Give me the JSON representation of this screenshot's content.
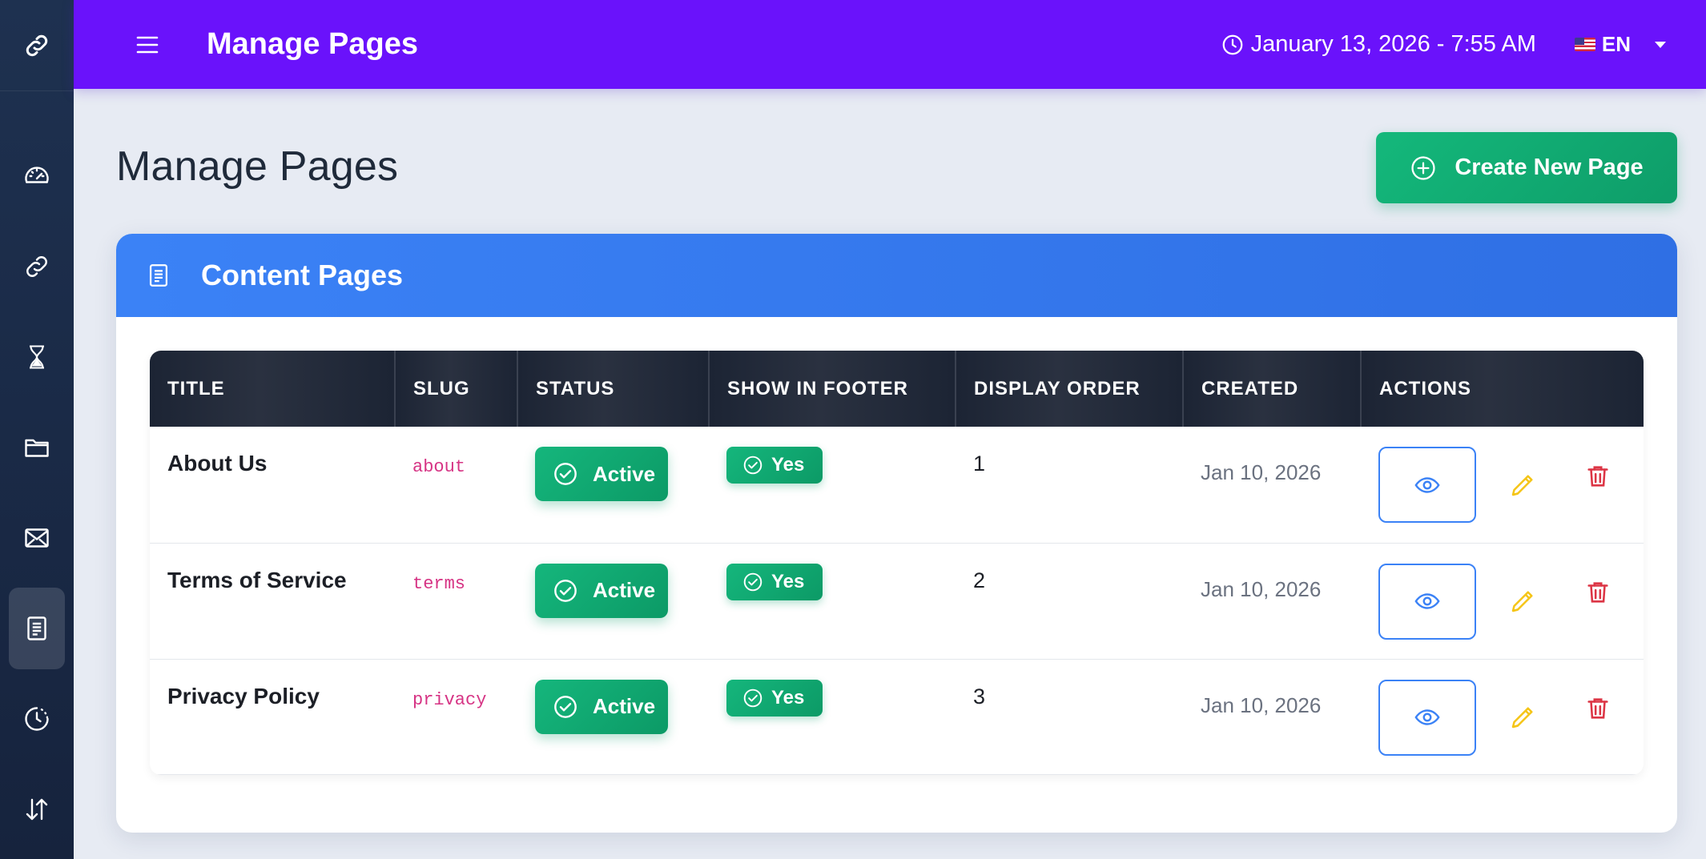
{
  "app": {
    "header_title": "Manage Pages",
    "datetime": "January 13, 2026 - 7:55 AM",
    "language": "EN"
  },
  "sidebar": {
    "items": [
      {
        "icon": "dashboard-gauge-icon"
      },
      {
        "icon": "link-icon"
      },
      {
        "icon": "hourglass-icon"
      },
      {
        "icon": "folder-icon"
      },
      {
        "icon": "envelope-icon"
      },
      {
        "icon": "document-icon",
        "active": true
      },
      {
        "icon": "history-clock-icon"
      },
      {
        "icon": "sort-arrows-icon"
      }
    ]
  },
  "main": {
    "page_title": "Manage Pages",
    "create_button_label": "Create New Page",
    "card_title": "Content Pages",
    "table": {
      "columns": [
        "TITLE",
        "SLUG",
        "STATUS",
        "SHOW IN FOOTER",
        "DISPLAY ORDER",
        "CREATED",
        "ACTIONS"
      ],
      "rows": [
        {
          "title": "About Us",
          "slug": "about",
          "status": "Active",
          "footer": "Yes",
          "order": "1",
          "created": "Jan 10, 2026"
        },
        {
          "title": "Terms of Service",
          "slug": "terms",
          "status": "Active",
          "footer": "Yes",
          "order": "2",
          "created": "Jan 10, 2026"
        },
        {
          "title": "Privacy Policy",
          "slug": "privacy",
          "status": "Active",
          "footer": "Yes",
          "order": "3",
          "created": "Jan 10, 2026"
        }
      ]
    }
  },
  "colors": {
    "topbar": "#6a12fb",
    "card_header": "#3b82f6",
    "success": "#10b981",
    "edit": "#f5c518",
    "delete": "#dc3545",
    "slug": "#d63384"
  }
}
